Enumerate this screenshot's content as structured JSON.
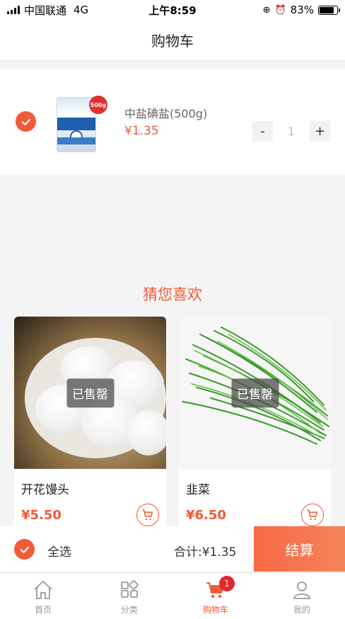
{
  "status_bar": {
    "carrier": "中国联通",
    "network": "4G",
    "time": "上午8:59",
    "battery": "83%",
    "battery_level": 0.83
  },
  "header": {
    "title": "购物车"
  },
  "cart_items": [
    {
      "name": "中盐碘盐(500g)",
      "price": "¥1.35",
      "quantity": "1",
      "minus_label": "-",
      "plus_label": "+",
      "image_badge": "500g"
    }
  ],
  "recommendations": {
    "title": "猜您喜欢",
    "items": [
      {
        "name": "开花馒头",
        "price": "¥5.50",
        "status": "已售罄"
      },
      {
        "name": "韭菜",
        "price": "¥6.50",
        "status": "已售罄"
      }
    ]
  },
  "checkout": {
    "select_all_label": "全选",
    "total_label": "合计:¥1.35",
    "checkout_button": "结算"
  },
  "tab_bar": {
    "tabs": [
      {
        "label": "首页",
        "icon": "home-icon"
      },
      {
        "label": "分类",
        "icon": "category-icon"
      },
      {
        "label": "购物车",
        "icon": "cart-icon",
        "badge": "1"
      },
      {
        "label": "我的",
        "icon": "user-icon"
      }
    ]
  },
  "colors": {
    "accent": "#f15a36",
    "badge": "#e5262c"
  }
}
